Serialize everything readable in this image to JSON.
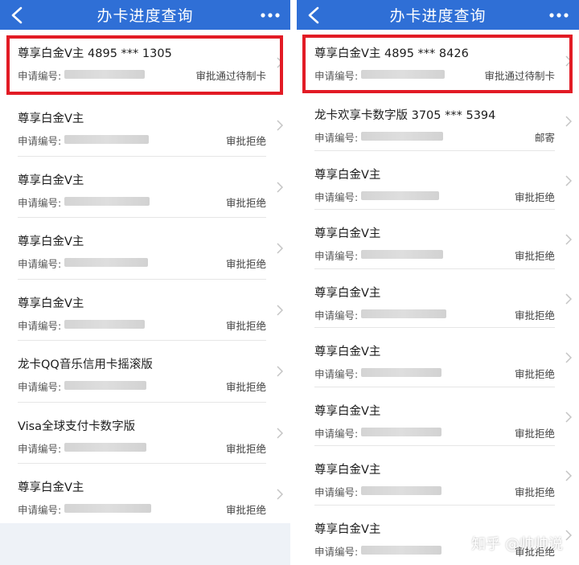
{
  "colors": {
    "header": "#2f6fd6",
    "highlight": "#e21b25"
  },
  "icons": {
    "back": "chevron-left-icon",
    "more": "more-dots-icon",
    "row": "chevron-right-icon"
  },
  "left": {
    "header": {
      "title": "办卡进度查询"
    },
    "items": [
      {
        "title": "尊享白金V主 4895 *** 1305",
        "label": "申请编号:",
        "status": "审批通过待制卡"
      },
      {
        "title": "尊享白金V主",
        "label": "申请编号:",
        "status": "审批拒绝"
      },
      {
        "title": "尊享白金V主",
        "label": "申请编号:",
        "status": "审批拒绝"
      },
      {
        "title": "尊享白金V主",
        "label": "申请编号:",
        "status": "审批拒绝"
      },
      {
        "title": "尊享白金V主",
        "label": "申请编号:",
        "status": "审批拒绝"
      },
      {
        "title": "龙卡QQ音乐信用卡摇滚版",
        "label": "申请编号:",
        "status": "审批拒绝"
      },
      {
        "title": "Visa全球支付卡数字版",
        "label": "申请编号:",
        "status": "审批拒绝"
      },
      {
        "title": "尊享白金V主",
        "label": "申请编号:",
        "status": "审批拒绝"
      }
    ]
  },
  "right": {
    "header": {
      "title": "办卡进度查询"
    },
    "items": [
      {
        "title": "尊享白金V主 4895 *** 8426",
        "label": "申请编号:",
        "status": "审批通过待制卡"
      },
      {
        "title": "龙卡欢享卡数字版 3705 *** 5394",
        "label": "申请编号:",
        "status": "邮寄"
      },
      {
        "title": "尊享白金V主",
        "label": "申请编号:",
        "status": "审批拒绝"
      },
      {
        "title": "尊享白金V主",
        "label": "申请编号:",
        "status": "审批拒绝"
      },
      {
        "title": "尊享白金V主",
        "label": "申请编号:",
        "status": "审批拒绝"
      },
      {
        "title": "尊享白金V主",
        "label": "申请编号:",
        "status": "审批拒绝"
      },
      {
        "title": "尊享白金V主",
        "label": "申请编号:",
        "status": "审批拒绝"
      },
      {
        "title": "尊享白金V主",
        "label": "申请编号:",
        "status": "审批拒绝"
      },
      {
        "title": "尊享白金V主",
        "label": "申请编号:",
        "status": "审批拒绝"
      }
    ]
  },
  "watermark": "知乎 @帅帅说"
}
